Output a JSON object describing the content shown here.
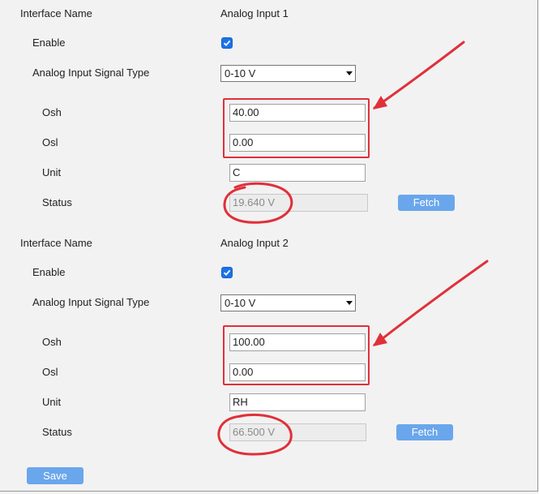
{
  "sections": [
    {
      "interface_name_label": "Interface Name",
      "interface_name_value": "Analog Input 1",
      "enable_label": "Enable",
      "enable_checked": true,
      "signal_type_label": "Analog Input Signal Type",
      "signal_type_value": "0-10 V",
      "osh_label": "Osh",
      "osh_value": "40.00",
      "osl_label": "Osl",
      "osl_value": "0.00",
      "unit_label": "Unit",
      "unit_value": "C",
      "status_label": "Status",
      "status_value": "19.640 V",
      "fetch_label": "Fetch"
    },
    {
      "interface_name_label": "Interface Name",
      "interface_name_value": "Analog Input 2",
      "enable_label": "Enable",
      "enable_checked": true,
      "signal_type_label": "Analog Input Signal Type",
      "signal_type_value": "0-10 V",
      "osh_label": "Osh",
      "osh_value": "100.00",
      "osl_label": "Osl",
      "osl_value": "0.00",
      "unit_label": "Unit",
      "unit_value": "RH",
      "status_label": "Status",
      "status_value": "66.500 V",
      "fetch_label": "Fetch"
    }
  ],
  "save_label": "Save",
  "colors": {
    "checkbox": "#1a73e8",
    "button": "#6aa6ec",
    "annotation": "#e0303a",
    "background": "#f2f2f2"
  },
  "icons": {
    "checkbox": "check-icon",
    "select_arrow": "triangle-down-icon"
  }
}
